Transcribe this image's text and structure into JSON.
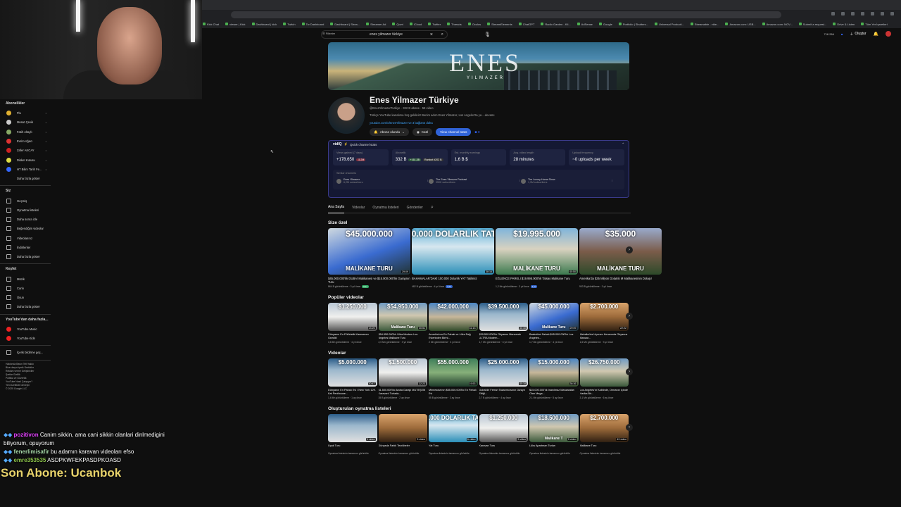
{
  "browser": {
    "bookmarks": [
      "Kick Chat",
      "viewer | Kick",
      "Dashboard | kick",
      "Twitch",
      "Tw Dashboard",
      "Dashboard | Strea...",
      "Streamer Ad",
      "Qovri",
      "iCloud",
      "Twitter",
      "Threads",
      "Oculus",
      "StreamElements",
      "ChatGPT",
      "Radio Garden - Kli...",
      "AdSense",
      "Google",
      "Portfolio | Shutters...",
      "Universal Producti...",
      "Streamable - vide...",
      "Amazon.com: USB...",
      "Amazon.com: NOV...",
      "Submit a request...",
      "Drive & Listen",
      "Tüm Yer İşaretleri"
    ]
  },
  "youtube": {
    "filter_label": "Filtreler",
    "search_value": "enes yilmazer türkiye",
    "right_stats": "716  264",
    "create_label": "Oluştur"
  },
  "sidebar": {
    "subs_title": "Abonelikler",
    "subs": [
      {
        "label": "Flu",
        "color": "#e0b030"
      },
      {
        "label": "Mesut Çevik",
        "color": "#ccc"
      },
      {
        "label": "Fatih Altaylı",
        "color": "#8a6"
      },
      {
        "label": "Evrim Ağacı",
        "color": "#d33"
      },
      {
        "label": "Zafer AKCAY",
        "color": "#c22"
      },
      {
        "label": "Disket Kutusu",
        "color": "#dd4"
      },
      {
        "label": "HT Bilim Tarih Fe...",
        "color": "#36f"
      }
    ],
    "more1": "Daha fazla göster",
    "you_title": "Siz",
    "you": [
      "Geçmiş",
      "Oynatma listeleri",
      "Daha sonra izle",
      "Beğendiğim videolar",
      "Videolarınız",
      "İndirilenler",
      "Daha fazla göster"
    ],
    "explore_title": "Keşfet",
    "explore": [
      "Müzik",
      "Canlı",
      "Oyun",
      "Daha fazla göster"
    ],
    "more_title": "YouTube'dan daha fazla...",
    "more": [
      {
        "label": "YouTube Music",
        "color": "#e22"
      },
      {
        "label": "YouTube Kids",
        "color": "#e22"
      }
    ],
    "report": "İçerik bildirme geç...",
    "footer": [
      "Hakkında  Basın  Telif hakkı",
      "Bize ulaşın  İçerik Üreticiler",
      "Reklam verme  Geliştiriciler",
      "Şartlar  Gizlilik",
      "Politika ve Güvenlik",
      "YouTube Nasıl Çalışıyor?",
      "Yeni özellikleri deneyin",
      "© 2025 Google LLC"
    ]
  },
  "chat": {
    "messages": [
      {
        "user": "pozitivon",
        "text": "Canim sikkin, ama cani sikkin olanlari dinlmedigini",
        "cls": "u1"
      },
      {
        "user": "",
        "text": "biliyorum, opuyorum",
        "cls": ""
      },
      {
        "user": "fenerlimisafir",
        "text": "bu adamın karavan videoları efso",
        "cls": "u2"
      },
      {
        "user": "emre353535",
        "text": "ASDPKWFEKPASDPKOASD",
        "cls": "u3"
      }
    ],
    "last_sub": "Son Abone: Ucanbok"
  },
  "channel": {
    "banner_logo": "ENES",
    "banner_sub": "YILMAZER",
    "name": "Enes Yilmazer Türkiye",
    "meta": "@EnesYilmazerTurkiye · 332 B abone · 59 video",
    "desc": "Türkçe YouTube kanalıma hoş geldiniz! Benim adım Enes Yilmazer, Los Angeles'ta ya ...devamı",
    "link": "youtube.com/c/EnesYilmazer  ve 3 bağlantı daha",
    "subscribed": "Abone olundu",
    "join": "Katıl",
    "vidiq_btn": "View channel stats"
  },
  "vidiq": {
    "brand": "vidIQ",
    "title": "Quick channel stats",
    "stats": [
      {
        "label": "Views gained (7 days)",
        "value": "+178.650",
        "tag": "-5,2M",
        "tagcolor": "#7a2a3a"
      },
      {
        "label": "Abonelik",
        "value": "332 B",
        "tag": "+161,3B",
        "tagcolor": "#2d5a3a",
        "tag2": "Rankıst #202 B"
      },
      {
        "label": "Est. monthly earnings",
        "value": "1,6 B $",
        "tag": "",
        "tagcolor": ""
      },
      {
        "label": "Avg. video length",
        "value": "28 minutes",
        "tag": "",
        "tagcolor": ""
      },
      {
        "label": "Upload frequency",
        "value": "~0 uploads per week",
        "tag": "",
        "tagcolor": ""
      }
    ],
    "similar_label": "Similar channels",
    "similar": [
      {
        "name": "Enes Yilmazer",
        "subs": "6,2M subscribers"
      },
      {
        "name": "The Enes Yilmazer Podcast",
        "subs": "950K subscribers"
      },
      {
        "name": "The Luxury Home Show",
        "subs": "1,9M subscribers"
      }
    ]
  },
  "tabs": [
    "Ana Sayfa",
    "Videolar",
    "Oynatma listeleri",
    "Gönderiler"
  ],
  "sections": [
    {
      "title": "Size özel",
      "size": "big",
      "items": [
        {
          "price": "$45.000.000",
          "tag": "MALİKANE TURU",
          "dur": "29:09",
          "title": "$45.000.000'lık DUBAİ Malikanesi ve $15.000.000'lık Garajının Turu",
          "meta": "864 B görüntüleme · 3 yıl önce",
          "chip": "8,1x",
          "chipc": "#3a6",
          "g": "g1"
        },
        {
          "price": "100.000 DOLARLIK TATİL",
          "tag": "",
          "dur": "38:16",
          "title": "BAHAMALAR'DAKİ 100.000 Dolarlık YAT Tatilimiz",
          "meta": "482 B görüntüleme · 4 yıl önce",
          "chip": "2,0x",
          "chipc": "#36c",
          "g": "g2"
        },
        {
          "price": "$19.995.000",
          "tag": "MALİKANE TURU",
          "dur": "40:50",
          "title": "EĞLENCE PARKLI $19.995.000'lık Tatsas Malikane Turu",
          "meta": "1,2 Mn görüntüleme · 3 yıl önce",
          "chip": "4,1x",
          "chipc": "#36c",
          "g": "g3"
        },
        {
          "price": "$35.000",
          "tag": "MALİKANE TURU",
          "dur": "",
          "title": "Amerika'da $35 Milyon Dolarlık M Malikanesinin Dolaşı!",
          "meta": "903 B görüntüleme · 3 yıl önce",
          "chip": "",
          "chipc": "",
          "g": "g4"
        }
      ]
    },
    {
      "title": "Popüler videolar",
      "size": "sm",
      "items": [
        {
          "price": "$1.250.000",
          "tag": "",
          "dur": "13:25",
          "title": "Dünyanın En Fütüristik Karavanını Gezdik!",
          "meta": "3,6 Mn görüntüleme · 4 yıl önce",
          "chip": "",
          "chipc": "",
          "g": "g5"
        },
        {
          "price": "$54.950.000",
          "tag": "Malikane Turu",
          "dur": "30:51",
          "title": "$54.950.000'lık Ultra Modern Los Angeles Malikane Turu",
          "meta": "2,0 Mn görüntüleme · 3 yıl önce",
          "chip": "",
          "chipc": "",
          "g": "g6"
        },
        {
          "price": "$42.000.000",
          "tag": "",
          "dur": "31:13",
          "title": "Amerika'nın En Pahalı ve Lüks Dağ Evlerinden Birini...",
          "meta": "2 Mn görüntüleme · 3 yıl önce",
          "chip": "",
          "chipc": "",
          "g": "g7"
        },
        {
          "price": "$39.500.000",
          "tag": "",
          "dur": "30:40",
          "title": "$39.500.000'lık Okyanus Manzaralı ULTRA Modern...",
          "meta": "1,7 Mn görüntüleme · 3 yıl önce",
          "chip": "",
          "chipc": "",
          "g": "g9"
        },
        {
          "price": "$45.000.000",
          "tag": "Malikane Turu",
          "dur": "29:09",
          "title": "Basketbol Sahalı $45.000.000'lık Los Angeles...",
          "meta": "1,7 Mn görüntüleme · 4 yıl önce",
          "chip": "",
          "chipc": "",
          "g": "g1"
        },
        {
          "price": "$2.700.000",
          "tag": "",
          "dur": "22:22",
          "title": "Meksika'da Uçurum Kenarında Okyanus Manzar...",
          "meta": "1,6 Mn görüntüleme · 3 yıl önce",
          "chip": "",
          "chipc": "",
          "g": "g10"
        }
      ]
    },
    {
      "title": "Videolar",
      "size": "sm",
      "items": [
        {
          "price": "$5.000.000",
          "tag": "",
          "dur": "30:47",
          "title": "Dünyanın En Pahalı Evi / New York 129. Kat Penthouse...",
          "meta": "1,6 Mn görüntüleme · 1 ay önce",
          "chip": "",
          "chipc": "",
          "g": "g9"
        },
        {
          "price": "$1.500.000",
          "tag": "",
          "dur": "22:23",
          "title": "$1.500.000'lık Araba Garajlı MUTEŞEM Karavan! Turlada...",
          "meta": "35 B görüntüleme · 2 ay önce",
          "chip": "",
          "chipc": "",
          "g": "g5"
        },
        {
          "price": "$55.000.000",
          "tag": "",
          "dur": "19:53",
          "title": "Minnesota'nın $55.000.000'lık En Pahalı Evi",
          "meta": "55 B görüntüleme · 3 ay önce",
          "chip": "",
          "chipc": "",
          "g": "g8"
        },
        {
          "price": "$25.000.000",
          "tag": "",
          "dur": "40:18",
          "title": "Dubai'de Ferrari Tasarımcısının Dizayn Ettiği...",
          "meta": "2,7 B görüntüleme · 4 ay önce",
          "chip": "",
          "chipc": "",
          "g": "g9"
        },
        {
          "price": "$15.000.000",
          "tag": "",
          "dur": "36:36",
          "title": "$15.000.000'lık İnanılmaz Manzaraları Olan Mega...",
          "meta": "2,1 Mn görüntüleme · 5 ay önce",
          "chip": "",
          "chipc": "",
          "g": "g7"
        },
        {
          "price": "$26.750.000",
          "tag": "",
          "dur": "",
          "title": "Los Angeles'ın Kalbinde, Ormanın İçinde Harika Bir...",
          "meta": "3,1 Mn görüntüleme · 6 ay önce",
          "chip": "",
          "chipc": "",
          "g": "g6"
        }
      ]
    },
    {
      "title": "Oluşturulan oynatma listeleri",
      "size": "sm",
      "items": [
        {
          "price": "",
          "tag": "",
          "dur": "5 video",
          "title": "Uçak Turu",
          "meta": "Oynatma listesinin tamamını görüntüle",
          "chip": "",
          "chipc": "",
          "g": "g9"
        },
        {
          "price": "",
          "tag": "",
          "dur": "3 video",
          "title": "Dünyada Farklı Tecrübeler",
          "meta": "Oynatma listesinin tamamını görüntüle",
          "chip": "",
          "chipc": "",
          "g": "g10"
        },
        {
          "price": "100.000 DOLARLIK TATİL",
          "tag": "",
          "dur": "6 video",
          "title": "Yat Turu",
          "meta": "Oynatma listesinin tamamını görüntüle",
          "chip": "",
          "chipc": "",
          "g": "g2"
        },
        {
          "price": "$1.250.000",
          "tag": "",
          "dur": "3 video",
          "title": "Karavan Turu",
          "meta": "Oynatma listesinin tamamını görüntüle",
          "chip": "",
          "chipc": "",
          "g": "g5"
        },
        {
          "price": "$18.500.000",
          "tag": "Malikane T",
          "dur": "5 video",
          "title": "Lüks Apartman Turları",
          "meta": "Oynatma listesinin tamamını görüntüle",
          "chip": "",
          "chipc": "",
          "g": "g6"
        },
        {
          "price": "$2.700.000",
          "tag": "",
          "dur": "43 video",
          "title": "Malikane Turu",
          "meta": "Oynatma listesinin tamamını görüntüle",
          "chip": "",
          "chipc": "",
          "g": "g10"
        }
      ]
    }
  ]
}
